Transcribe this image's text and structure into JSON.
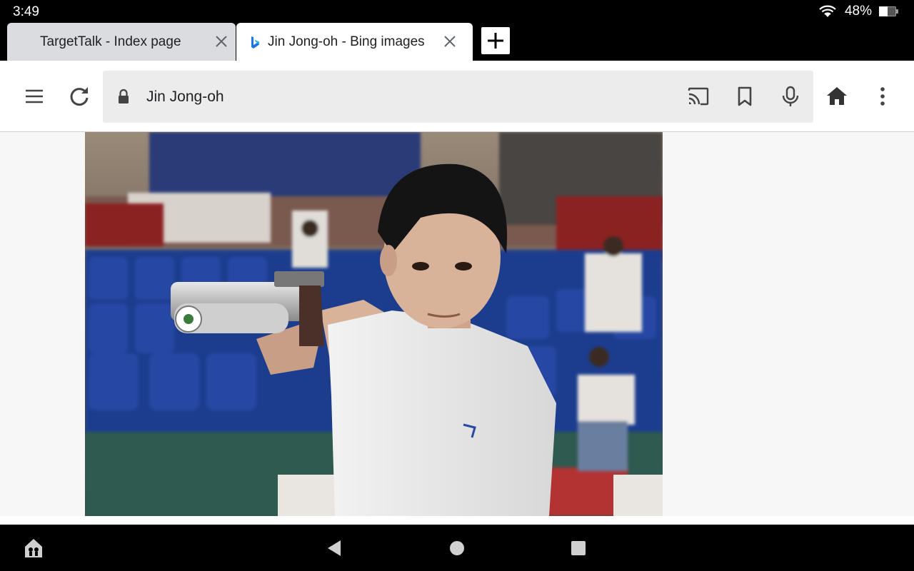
{
  "status": {
    "time": "3:49",
    "battery_text": "48%",
    "battery_level": 0.48,
    "wifi_icon": "wifi-icon",
    "battery_icon": "battery-icon"
  },
  "tabs": [
    {
      "title": "TargetTalk - Index page",
      "active": false,
      "close_icon": "close-icon"
    },
    {
      "title": "Jin Jong-oh - Bing images",
      "active": true,
      "favicon": "bing-icon",
      "close_icon": "close-icon"
    }
  ],
  "new_tab_icon": "plus-icon",
  "toolbar": {
    "menu_icon": "hamburger-menu-icon",
    "reload_icon": "reload-icon",
    "omnibox_text": "Jin Jong-oh",
    "lock_icon": "lock-icon",
    "cast_icon": "cast-icon",
    "bookmark_icon": "bookmark-icon",
    "mic_icon": "microphone-icon",
    "home_icon": "home-icon",
    "more_icon": "more-vert-icon"
  },
  "content": {
    "image_subject": "Shooter aiming air pistol in stadium"
  },
  "nav": {
    "accessibility_icon": "accessibility-icon",
    "back_icon": "back-icon",
    "home_icon": "nav-home-icon",
    "recents_icon": "recents-icon"
  },
  "colors": {
    "bing_blue": "#1a73e8",
    "accent_dark": "#333333"
  }
}
